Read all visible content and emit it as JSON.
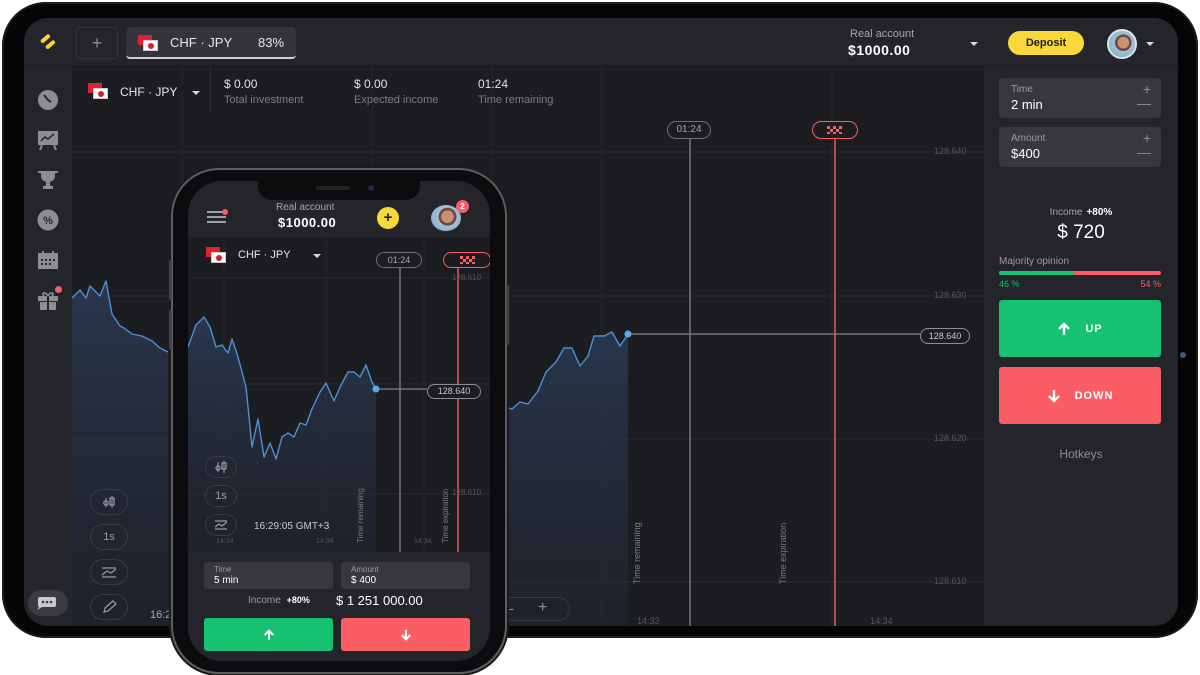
{
  "tablet": {
    "topbar": {
      "add_tab_label": "+",
      "asset_tab": {
        "name": "CHF · JPY",
        "payout": "83%"
      },
      "account_label": "Real account",
      "account_balance": "$1000.00",
      "deposit_label": "Deposit",
      "avatar_icon": "user-avatar"
    },
    "sidebar": {
      "items": [
        {
          "icon": "clock-icon"
        },
        {
          "icon": "chart-board-icon"
        },
        {
          "icon": "trophy-icon"
        },
        {
          "icon": "percent-badge-icon"
        },
        {
          "icon": "calendar-icon"
        },
        {
          "icon": "gift-icon",
          "badge": true
        }
      ],
      "chat_icon": "chat-icon"
    },
    "chart_header": {
      "asset": "CHF · JPY",
      "stats": [
        {
          "value": "$ 0.00",
          "label": "Total investment"
        },
        {
          "value": "$ 0.00",
          "label": "Expected income"
        },
        {
          "value": "01:24",
          "label": "Time remaining"
        }
      ]
    },
    "chart": {
      "timer_pill": "01:24",
      "price_ticks": [
        "128.640",
        "128.630",
        "128.620",
        "128.610"
      ],
      "current_price": "128.640",
      "time_remaining_label": "Time remaining",
      "time_expiration_label": "Time expiration",
      "time_ticks": [
        "14:33",
        "14:34"
      ],
      "clock_partial": "16:2",
      "zoom_minus": "−",
      "zoom_plus": "+",
      "tools": [
        {
          "icon": "candlestick-icon",
          "label": ""
        },
        {
          "icon": "interval-icon",
          "label": "1s"
        },
        {
          "icon": "indicator-icon",
          "label": ""
        },
        {
          "icon": "pencil-icon",
          "label": ""
        }
      ]
    },
    "right_panel": {
      "time": {
        "label": "Time",
        "value": "2 min"
      },
      "amount": {
        "label": "Amount",
        "value": "$400"
      },
      "income_label": "Income",
      "income_pct": "+80%",
      "income_value": "$ 720",
      "majority_label": "Majority opinion",
      "majority_up_pct": 46,
      "majority_up_label": "46 %",
      "majority_down_label": "54 %",
      "up_label": "UP",
      "down_label": "DOWN",
      "hotkeys_label": "Hotkeys",
      "colors": {
        "up": "#16c172",
        "down": "#fa5d63",
        "deposit": "#fbd83a"
      }
    }
  },
  "phone": {
    "account_label": "Real account",
    "account_balance": "$1000.00",
    "notification_count": "2",
    "asset": "CHF · JPY",
    "timer_pill": "01:24",
    "price_ticks": [
      "128.610",
      "128.610"
    ],
    "current_price": "128.640",
    "time_remaining_label": "Time remaining",
    "time_expiration_label": "Time expiration",
    "clock": "16:29:05 GMT+3",
    "time_ticks": [
      "14:34",
      "14:34",
      "14:34"
    ],
    "interval_label": "1s",
    "time": {
      "label": "Time",
      "value": "5 min"
    },
    "amount": {
      "label": "Amount",
      "value": "$ 400"
    },
    "income_label": "Income",
    "income_pct": "+80%",
    "income_value": "$ 1 251 000.00"
  }
}
